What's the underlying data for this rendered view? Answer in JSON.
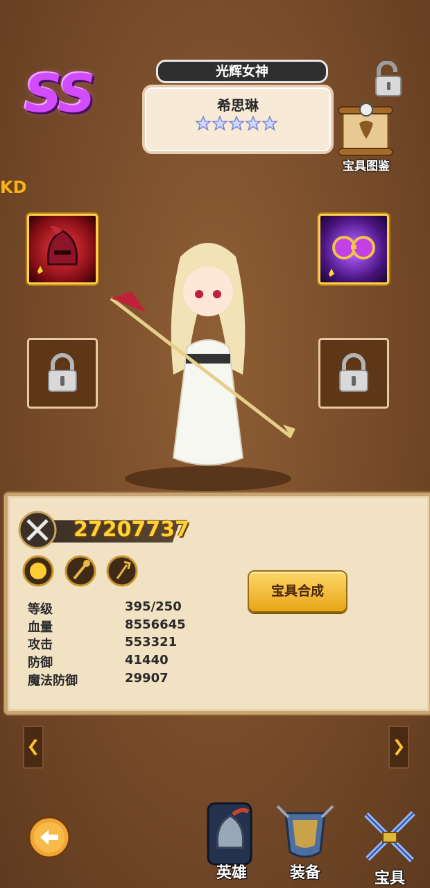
{
  "hero": {
    "rank": "SS",
    "title": "光辉女神",
    "name": "希思琳",
    "star_count": 5
  },
  "codex_label": "宝具图鉴",
  "side_label": "KD",
  "power": "27207737",
  "merge_button": "宝具合成",
  "stats": [
    {
      "label": "等级",
      "value": "395/250"
    },
    {
      "label": "血量",
      "value": "8556645"
    },
    {
      "label": "攻击",
      "value": "553321"
    },
    {
      "label": "防御",
      "value": "41440"
    },
    {
      "label": "魔法防御",
      "value": "29907"
    }
  ],
  "nav": {
    "hero": "英雄",
    "equipment": "装备",
    "treasure": "宝具"
  },
  "icons": [
    "lock-icon",
    "scroll-codex-icon",
    "red-helmet-icon",
    "purple-goggles-icon",
    "crossed-swords-icon",
    "gold-orb-skill-icon",
    "gold-scepter-skill-icon",
    "gold-trident-skill-icon",
    "chevron-left-icon",
    "chevron-right-icon",
    "back-arrow-icon",
    "hero-helmet-icon",
    "armor-icon",
    "crossed-blades-icon"
  ],
  "colors": {
    "background": "#7a4e2b",
    "panel": "#f2e2c4",
    "power_text": "#ffd23a",
    "rank": "#d24cff",
    "button": "#e7a617"
  }
}
